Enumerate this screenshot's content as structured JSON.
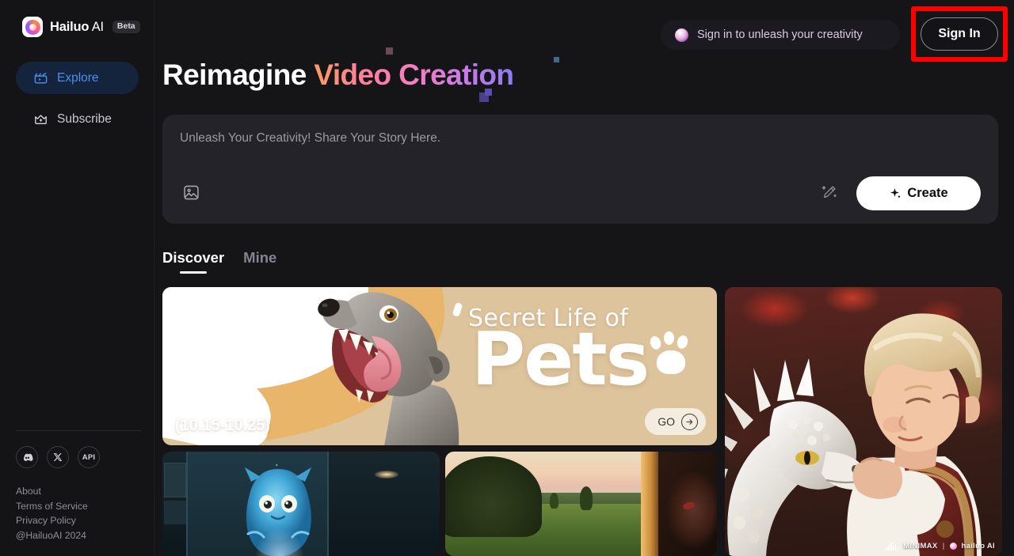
{
  "brand": {
    "name": "Hailuo",
    "name_suffix": " AI",
    "badge": "Beta",
    "logo_icon": "hailuo-spiral-logo"
  },
  "sidebar": {
    "items": [
      {
        "label": "Explore",
        "icon": "clapperboard-icon",
        "active": true
      },
      {
        "label": "Subscribe",
        "icon": "crown-icon",
        "active": false
      }
    ],
    "social": [
      {
        "name": "discord-icon",
        "label": ""
      },
      {
        "name": "x-twitter-icon",
        "label": ""
      },
      {
        "name": "api-icon",
        "label": "API"
      }
    ],
    "links": [
      "About",
      "Terms of Service",
      "Privacy Policy",
      "@HailuoAI 2024"
    ]
  },
  "header": {
    "signin_pill_text": "Sign in to unleash your creativity",
    "signin_pill_icon": "shell-gem-icon",
    "signin_button": "Sign In",
    "highlight_color": "#ff0000"
  },
  "hero": {
    "title_plain": "Reimagine",
    "title_gradient": "Video Creation",
    "gradient_from": "#ff9a62",
    "gradient_to": "#8b7df0"
  },
  "prompt": {
    "placeholder": "Unleash Your Creativity! Share Your Story Here.",
    "value": "",
    "image_icon": "image-upload-icon",
    "pencil_icon": "magic-pencil-icon",
    "create_label": "Create",
    "create_icon": "sparkle-icon"
  },
  "tabs": [
    {
      "label": "Discover",
      "active": true
    },
    {
      "label": "Mine",
      "active": false
    }
  ],
  "cards": {
    "banner": {
      "heading": "Secret Life of",
      "headline": "Pets",
      "date_range": "(10.15-10.25)",
      "cta_label": "GO",
      "cta_icon": "arrow-right-circle-icon"
    },
    "dragon": {
      "alt": "boy embracing a white dragon among red autumn leaves",
      "watermark_primary": "MINIMAX",
      "watermark_separator": "|",
      "watermark_secondary": "hailuo AI"
    },
    "cat": {
      "alt": "blue furry creature cooking in a kitchen"
    },
    "field": {
      "alt": "sunset countryside field beside a woman at a window"
    }
  }
}
